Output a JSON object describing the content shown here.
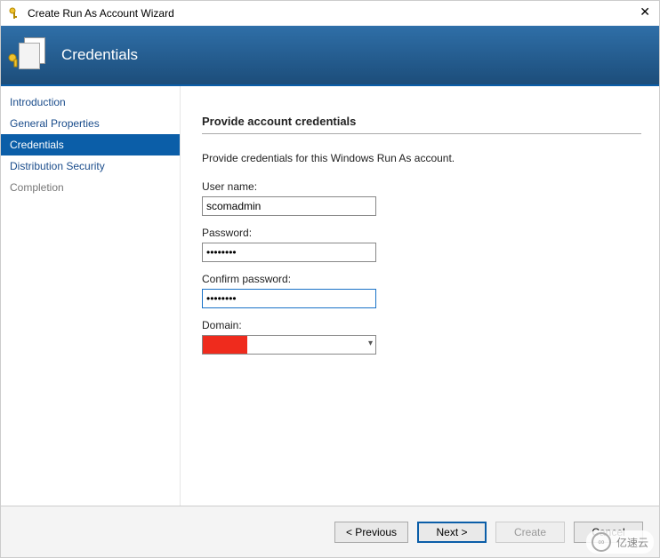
{
  "window": {
    "title": "Create Run As Account Wizard",
    "close": "✕"
  },
  "header": {
    "title": "Credentials"
  },
  "sidebar": {
    "items": [
      {
        "label": "Introduction"
      },
      {
        "label": "General Properties"
      },
      {
        "label": "Credentials"
      },
      {
        "label": "Distribution Security"
      },
      {
        "label": "Completion"
      }
    ],
    "activeIndex": 2
  },
  "content": {
    "heading": "Provide account credentials",
    "description": "Provide credentials for this Windows Run As account.",
    "username_label": "User name:",
    "username_value": "scomadmin",
    "password_label": "Password:",
    "password_value": "••••••••",
    "confirm_label": "Confirm password:",
    "confirm_value": "••••••••",
    "domain_label": "Domain:",
    "domain_value": ""
  },
  "footer": {
    "previous": "< Previous",
    "next": "Next >",
    "create": "Create",
    "cancel": "Cancel"
  },
  "watermark": {
    "text": "亿速云"
  }
}
